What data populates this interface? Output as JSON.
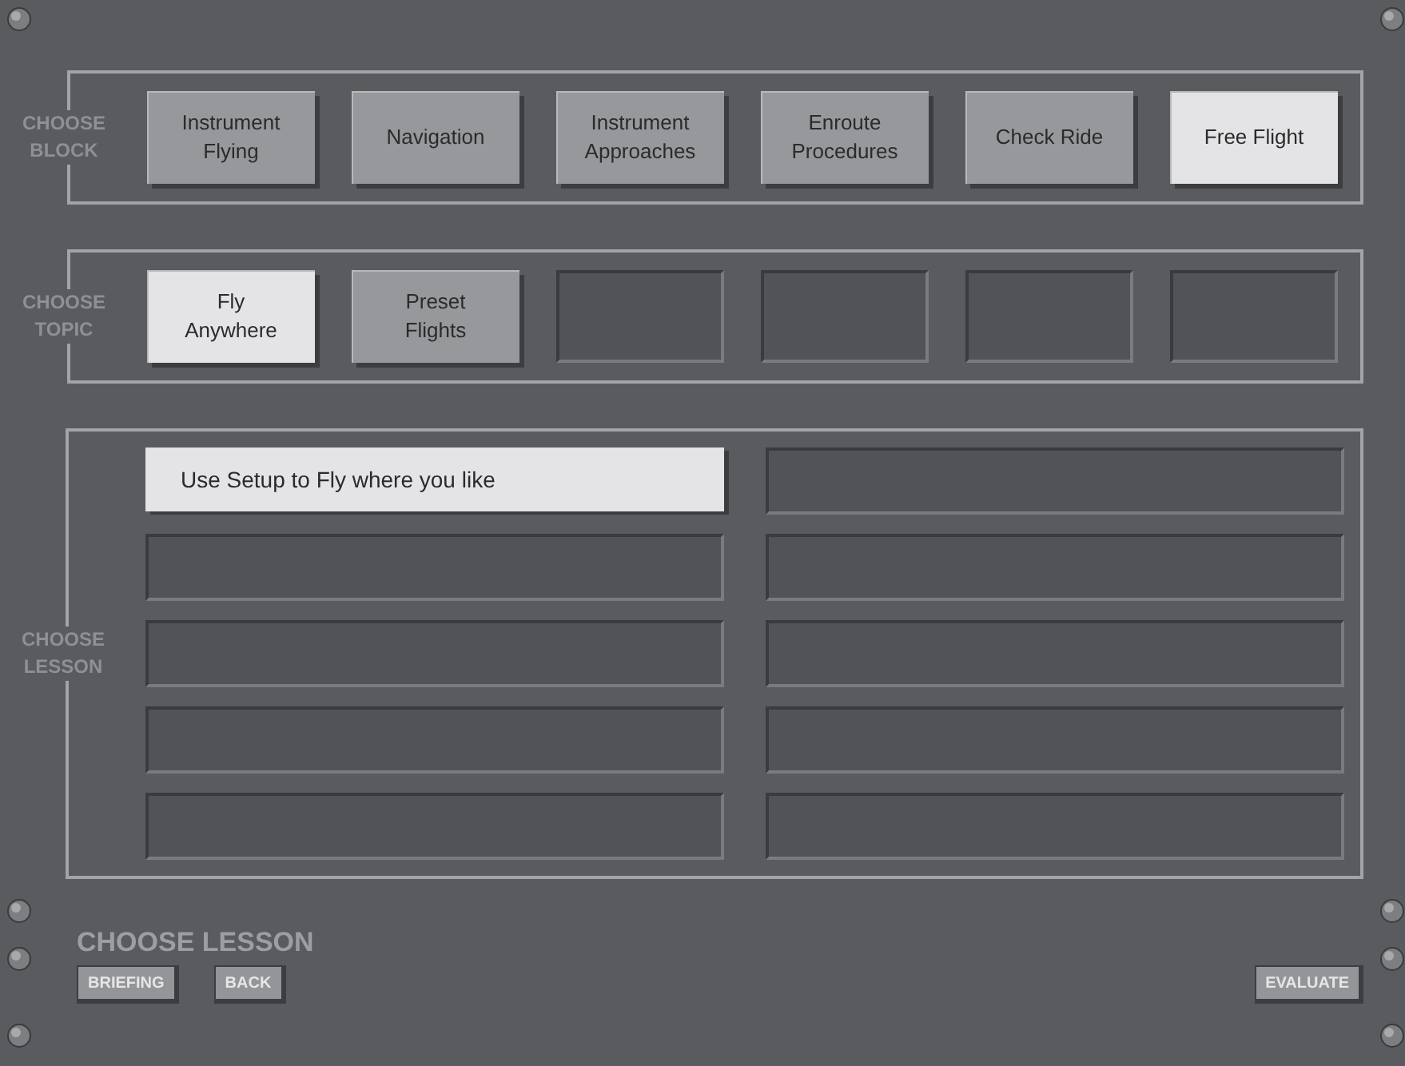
{
  "block_section": {
    "label": "CHOOSE BLOCK",
    "items": [
      {
        "kind": "button",
        "label": "Instrument Flying",
        "selected": false
      },
      {
        "kind": "button",
        "label": "Navigation",
        "selected": false
      },
      {
        "kind": "button",
        "label": "Instrument Approaches",
        "selected": false
      },
      {
        "kind": "button",
        "label": "Enroute Procedures",
        "selected": false
      },
      {
        "kind": "button",
        "label": "Check Ride",
        "selected": false
      },
      {
        "kind": "button",
        "label": "Free Flight",
        "selected": true
      }
    ]
  },
  "topic_section": {
    "label": "CHOOSE TOPIC",
    "items": [
      {
        "kind": "button",
        "label": "Fly Anywhere",
        "selected": true
      },
      {
        "kind": "button",
        "label": "Preset Flights",
        "selected": false
      },
      {
        "kind": "blank",
        "selected": false
      },
      {
        "kind": "blank",
        "selected": false
      },
      {
        "kind": "blank",
        "selected": false
      },
      {
        "kind": "blank",
        "selected": false
      }
    ]
  },
  "lesson_section": {
    "label": "CHOOSE LESSON",
    "items": [
      {
        "kind": "button",
        "label": "Use Setup to Fly where you like",
        "selected": true
      },
      {
        "kind": "blank",
        "selected": false
      },
      {
        "kind": "blank",
        "selected": false
      },
      {
        "kind": "blank",
        "selected": false
      },
      {
        "kind": "blank",
        "selected": false
      },
      {
        "kind": "blank",
        "selected": false
      },
      {
        "kind": "blank",
        "selected": false
      },
      {
        "kind": "blank",
        "selected": false
      },
      {
        "kind": "blank",
        "selected": false
      },
      {
        "kind": "blank",
        "selected": false
      }
    ]
  },
  "footer": {
    "title": "CHOOSE LESSON",
    "buttons": [
      "BRIEFING",
      "BACK"
    ],
    "right_button": "EVALUATE"
  }
}
